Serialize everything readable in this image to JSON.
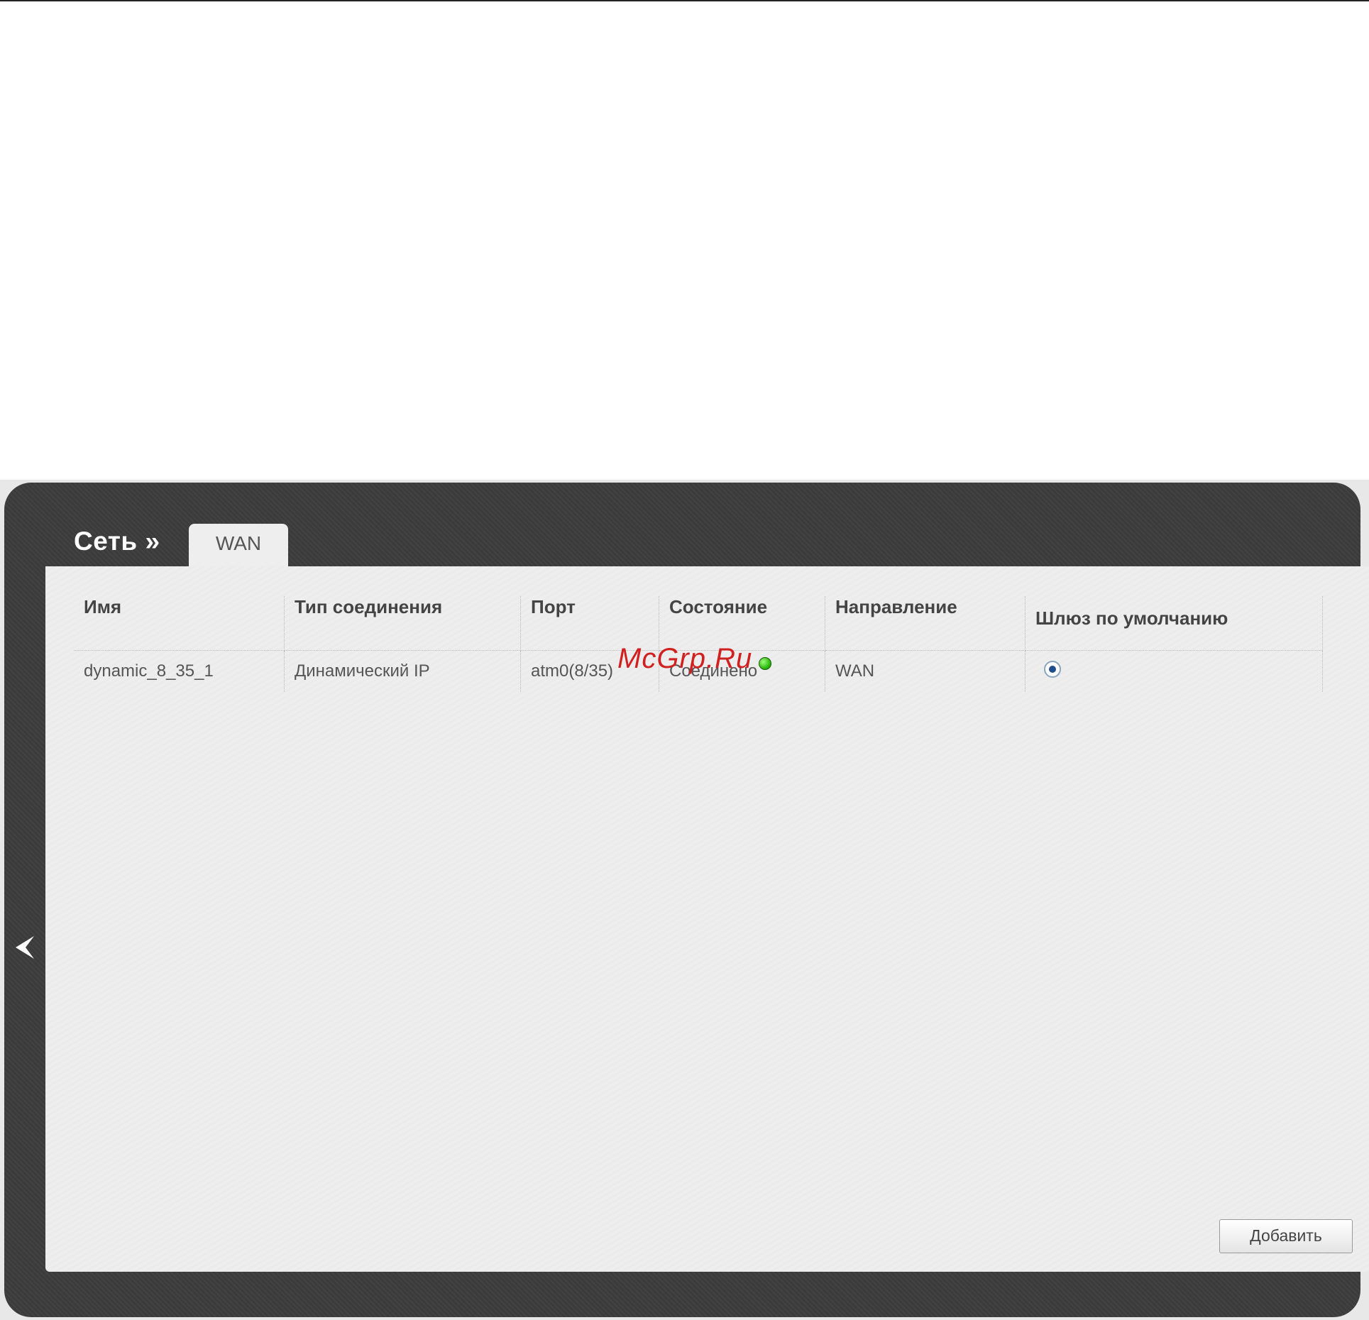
{
  "header": {
    "breadcrumb": "Сеть »",
    "tab_label": "WAN"
  },
  "table": {
    "columns": [
      "Имя",
      "Тип соединения",
      "Порт",
      "Состояние",
      "Направление",
      "Шлюз по умолчанию"
    ],
    "rows": [
      {
        "name": "dynamic_8_35_1",
        "type": "Динамический IP",
        "port": "atm0(8/35)",
        "status": "Соединено",
        "direction": "WAN",
        "default_gateway": true
      }
    ]
  },
  "actions": {
    "add_label": "Добавить"
  },
  "watermark": "McGrp.Ru",
  "colors": {
    "panel": "#3d3d3d",
    "content": "#eeeeee",
    "status_ok": "#20b000",
    "watermark": "#d02020"
  },
  "icons": {
    "back": "chevron-left-icon",
    "status": "status-ok-icon"
  }
}
